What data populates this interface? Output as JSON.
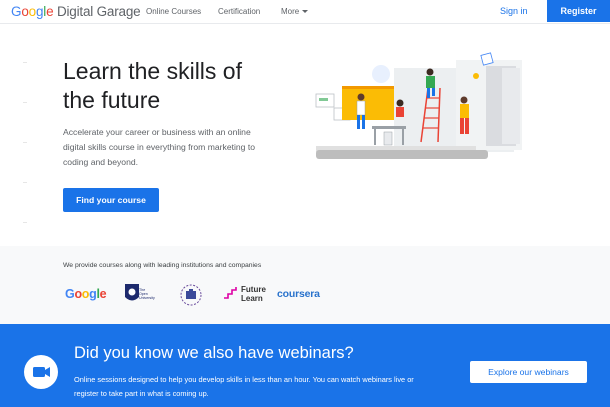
{
  "header": {
    "logo_google": [
      "G",
      "o",
      "o",
      "g",
      "l",
      "e"
    ],
    "logo_suffix": "Digital Garage",
    "nav": [
      "Online Courses",
      "Certification",
      "More"
    ],
    "signin": "Sign in",
    "register": "Register"
  },
  "hero": {
    "title_line1": "Learn the skills of",
    "title_line2": "the future",
    "description": "Accelerate your career or business with an online digital skills course in everything from marketing to coding and beyond.",
    "cta": "Find your course"
  },
  "partners": {
    "intro": "We provide courses along with leading institutions and companies",
    "google": "Google",
    "ou": [
      "The Open",
      "University"
    ],
    "futurelearn": [
      "Future",
      "Learn"
    ],
    "coursera": "coursera"
  },
  "webinar": {
    "title": "Did you know we also have webinars?",
    "description": "Online sessions designed to help you develop skills in less than an hour. You can watch webinars live or register to take part in what is coming up.",
    "cta": "Explore our webinars"
  },
  "colors": {
    "brand_blue": "#1a73e8",
    "google_blue": "#4285f4",
    "google_red": "#ea4335",
    "google_yellow": "#fbbc05",
    "google_green": "#34a853"
  },
  "icons": {
    "webinar": "video-camera-icon",
    "more": "chevron-down-icon"
  }
}
